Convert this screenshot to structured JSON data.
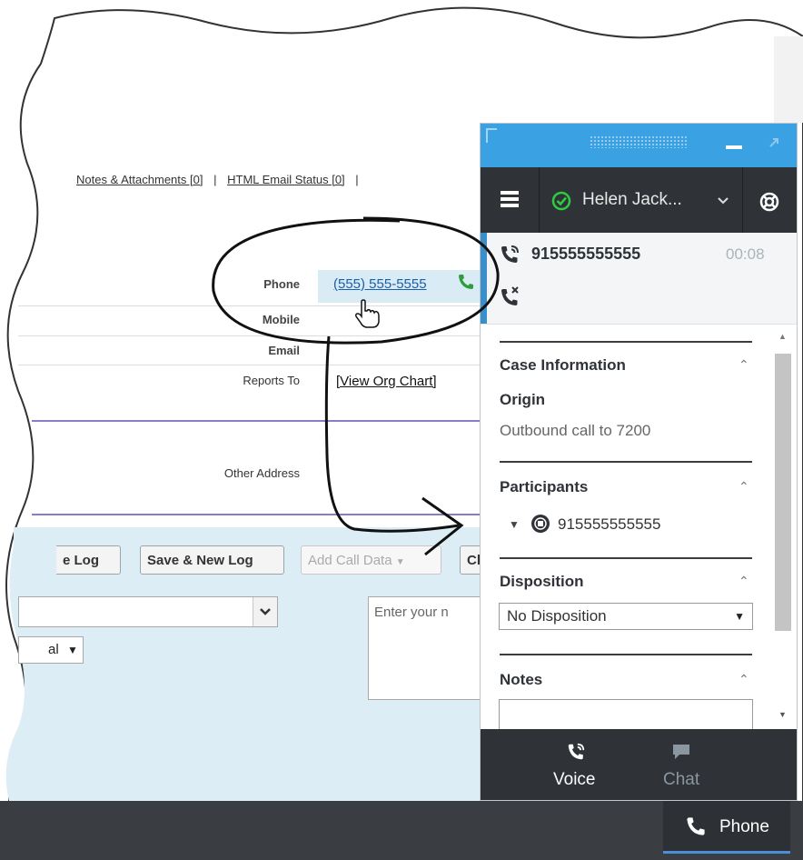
{
  "background_page": {
    "links": {
      "notes_attachments": "Notes & Attachments [0]",
      "separator_1": "|",
      "html_email_status": "HTML Email Status [0]",
      "separator_2": "|"
    },
    "fields": {
      "phone_label": "Phone",
      "phone_value": "(555) 555-5555",
      "mobile_label": "Mobile",
      "email_label": "Email",
      "reports_to_label": "Reports To",
      "reports_to_value": "[View Org Chart]",
      "other_address_label": "Other Address"
    },
    "buttons": {
      "save_log": "e Log",
      "save_new_log": "Save & New Log",
      "add_call_data": "Add Call Data",
      "clear_partial": "Cl"
    },
    "controls": {
      "small_select_value": "al",
      "comments_placeholder": "Enter your n"
    },
    "bottom_bar": {
      "phone_tab": "Phone"
    }
  },
  "widget": {
    "toolbar": {
      "agent_name": "Helen Jack...",
      "agent_status": "ready"
    },
    "call": {
      "number": "915555555555",
      "timer": "00:08"
    },
    "sections": {
      "case_info": {
        "title": "Case Information",
        "origin_label": "Origin",
        "origin_value": "Outbound call to 7200"
      },
      "participants": {
        "title": "Participants",
        "participant_number": "915555555555"
      },
      "disposition": {
        "title": "Disposition",
        "selected": "No Disposition"
      },
      "notes": {
        "title": "Notes"
      }
    },
    "footer": {
      "voice_label": "Voice",
      "chat_label": "Chat"
    }
  },
  "colors": {
    "widget_titlebar": "#3aa2e2",
    "widget_dark": "#2f3338",
    "ready_green": "#2ecc40",
    "link_blue": "#1a5fa8",
    "content_bg": "#dcedf6"
  }
}
